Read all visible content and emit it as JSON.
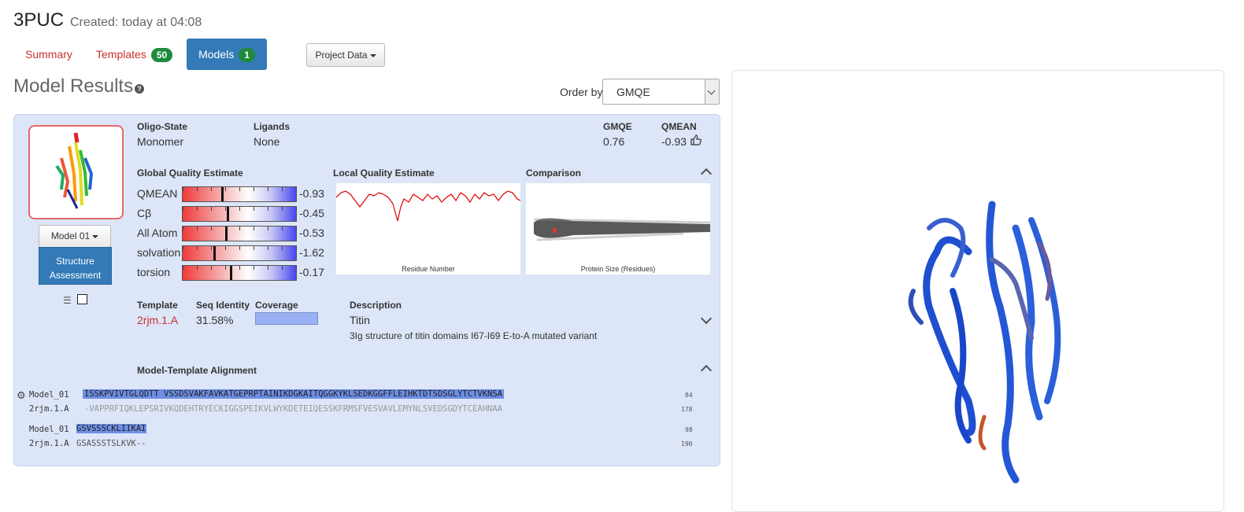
{
  "header": {
    "project": "3PUC",
    "created": "Created: today at 04:08"
  },
  "tabs": [
    {
      "label": "Summary"
    },
    {
      "label": "Templates",
      "count": "50"
    },
    {
      "label": "Models",
      "count": "1"
    }
  ],
  "project_data_label": "Project Data",
  "results": {
    "title": "Model Results",
    "order_label": "Order by:",
    "order_value": "GMQE"
  },
  "model": {
    "select_label": "Model 01",
    "structure_btn_line1": "Structure",
    "structure_btn_line2": "Assessment",
    "oligo_label": "Oligo-State",
    "oligo_value": "Monomer",
    "ligands_label": "Ligands",
    "ligands_value": "None",
    "gmqe_label": "GMQE",
    "gmqe_value": "0.76",
    "qmean_label": "QMEAN",
    "qmean_value": "-0.93",
    "global_title": "Global Quality Estimate",
    "global_rows": [
      {
        "label": "QMEAN",
        "value": "-0.93",
        "score": -0.93
      },
      {
        "label": "Cβ",
        "value": "-0.45",
        "score": -0.45
      },
      {
        "label": "All Atom",
        "value": "-0.53",
        "score": -0.53
      },
      {
        "label": "solvation",
        "value": "-1.62",
        "score": -1.62
      },
      {
        "label": "torsion",
        "value": "-0.17",
        "score": -0.17
      }
    ],
    "local_title": "Local Quality Estimate",
    "local_xlabel": "Residue Number",
    "comparison_title": "Comparison",
    "comparison_xlabel": "Protein Size (Residues)",
    "template_label": "Template",
    "template_value": "2rjm.1.A",
    "seqid_label": "Seq Identity",
    "seqid_value": "31.58%",
    "coverage_label": "Coverage",
    "coverage_fraction": 1.0,
    "desc_label": "Description",
    "desc_value": "Titin",
    "desc_detail": "3Ig structure of titin domains I67-I69 E-to-A mutated variant",
    "alignment_title": "Model-Template Alignment",
    "alignment": [
      {
        "name": "Model_01",
        "seq": "ISSKPVIVTGLQDTT VSSDSVAKFAVKATGEPRPTAINIKDGKAITQGGKYKLSEDKGGFFLEIHKTDTSDSGLYTCTVKNSA",
        "end": "84"
      },
      {
        "name": "2rjm.1.A",
        "seq": "-VAPPRFIQKLEPSRIVKQDEHTRYECKIGGSPEIKVLWYKDETEIQESSKFRMSFVESVAVLEMYNLSVEDSGDYTCEAHNAA",
        "end": "178"
      },
      {
        "name": "Model_01",
        "seq": "GSVSSSCKLIIKAI",
        "end": "98"
      },
      {
        "name": "2rjm.1.A",
        "seq": "GSASSSTSLKVK--",
        "end": "190"
      }
    ]
  },
  "icons": {
    "help": "question-circle-icon",
    "thumbs_up": "thumbs-up-icon",
    "gear": "gear-icon"
  },
  "colors": {
    "accent": "#337ab7",
    "link": "#c9302c",
    "badge": "#1e8a3c",
    "card": "#dce6f8"
  }
}
